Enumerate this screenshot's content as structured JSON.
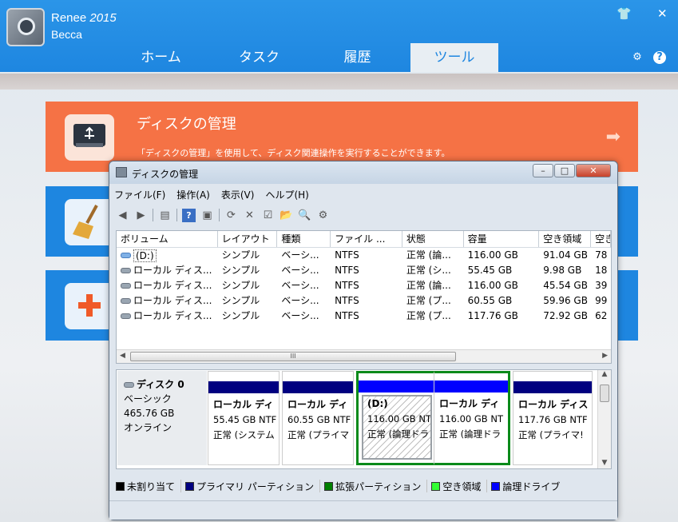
{
  "app": {
    "title": "Renee",
    "version": "2015",
    "user": "Becca",
    "controls": {
      "shirt_icon": "shirt-icon",
      "close": "✕"
    },
    "tabs": [
      {
        "label": "ホーム",
        "active": false
      },
      {
        "label": "タスク",
        "active": false
      },
      {
        "label": "履歴",
        "active": false
      },
      {
        "label": "ツール",
        "active": true
      }
    ],
    "header_icons": [
      "gear-icon",
      "help-icon"
    ],
    "colors": {
      "header": "#1e86e0",
      "orange_card": "#f57245",
      "blue_card": "#1e86e0"
    }
  },
  "cards": [
    {
      "title": "ディスクの管理",
      "desc": "「ディスクの管理」を使用して、ディスク関連操作を実行することができます。",
      "icon": "usb-drive-icon"
    },
    {
      "title": "",
      "icon": "broom-icon"
    },
    {
      "title": "",
      "icon": "first-aid-icon"
    }
  ],
  "disk_mgmt": {
    "title": "ディスクの管理",
    "menu": [
      "ファイル(F)",
      "操作(A)",
      "表示(V)",
      "ヘルプ(H)"
    ],
    "columns": [
      "ボリューム",
      "レイアウト",
      "種類",
      "ファイル ...",
      "状態",
      "容量",
      "空き領域",
      "空き"
    ],
    "rows": [
      {
        "volume": "(D:)",
        "layout": "シンプル",
        "type": "ベーシ...",
        "fs": "NTFS",
        "status": "正常 (論...",
        "capacity": "116.00 GB",
        "free": "91.04 GB",
        "pct": "78"
      },
      {
        "volume": "ローカル ディス...",
        "layout": "シンプル",
        "type": "ベーシ...",
        "fs": "NTFS",
        "status": "正常 (シ...",
        "capacity": "55.45 GB",
        "free": "9.98 GB",
        "pct": "18"
      },
      {
        "volume": "ローカル ディス...",
        "layout": "シンプル",
        "type": "ベーシ...",
        "fs": "NTFS",
        "status": "正常 (論...",
        "capacity": "116.00 GB",
        "free": "45.54 GB",
        "pct": "39"
      },
      {
        "volume": "ローカル ディス...",
        "layout": "シンプル",
        "type": "ベーシ...",
        "fs": "NTFS",
        "status": "正常 (プ...",
        "capacity": "60.55 GB",
        "free": "59.96 GB",
        "pct": "99"
      },
      {
        "volume": "ローカル ディス...",
        "layout": "シンプル",
        "type": "ベーシ...",
        "fs": "NTFS",
        "status": "正常 (プ...",
        "capacity": "117.76 GB",
        "free": "72.92 GB",
        "pct": "62"
      }
    ],
    "scroll_thumb": "III",
    "disk": {
      "name": "ディスク 0",
      "type": "ベーシック",
      "size": "465.76 GB",
      "state": "オンライン"
    },
    "partitions": [
      {
        "label": "ローカル ディ",
        "size": "55.45 GB NTF",
        "status": "正常 (システム",
        "bar": "#000080"
      },
      {
        "label": "ローカル ディ",
        "size": "60.55 GB NTF",
        "status": "正常 (プライマ",
        "bar": "#000080"
      },
      {
        "label": "(D:)",
        "size": "116.00 GB NT",
        "status": "正常 (論理ドラ",
        "bar": "#0000ff"
      },
      {
        "label": "ローカル ディ",
        "size": "116.00 GB NT",
        "status": "正常 (論理ドラ",
        "bar": "#0000ff"
      },
      {
        "label": "ローカル ディス",
        "size": "117.76 GB NTF",
        "status": "正常 (プライマ!",
        "bar": "#000080"
      }
    ],
    "legend": [
      {
        "label": "未割り当て",
        "color": "#000000"
      },
      {
        "label": "プライマリ パーティション",
        "color": "#000080"
      },
      {
        "label": "拡張パーティション",
        "color": "#008000"
      },
      {
        "label": "空き領域",
        "color": "#33ff33"
      },
      {
        "label": "論理ドライブ",
        "color": "#0000ff"
      }
    ]
  }
}
